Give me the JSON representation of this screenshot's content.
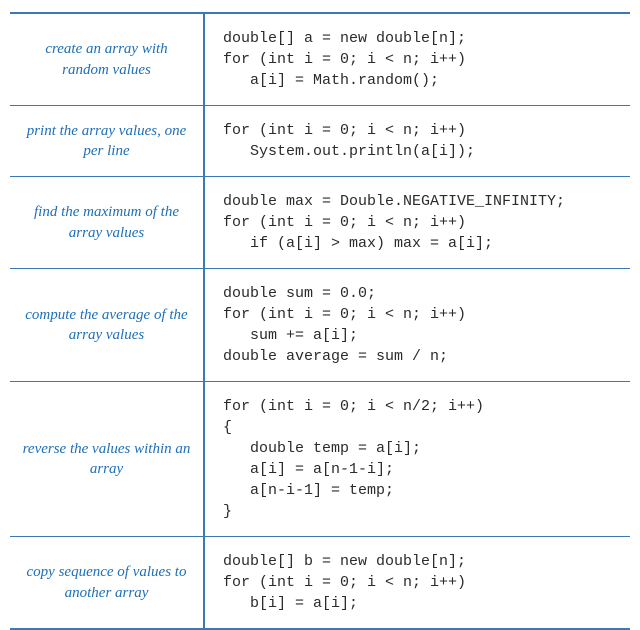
{
  "rows": [
    {
      "label": "create an array\nwith random values",
      "code": "double[] a = new double[n];\nfor (int i = 0; i < n; i++)\n   a[i] = Math.random();"
    },
    {
      "label": "print the array values,\none per line",
      "code": "for (int i = 0; i < n; i++)\n   System.out.println(a[i]);"
    },
    {
      "label": "find the maximum of\nthe array values",
      "code": "double max = Double.NEGATIVE_INFINITY;\nfor (int i = 0; i < n; i++)\n   if (a[i] > max) max = a[i];"
    },
    {
      "label": "compute the average of\nthe array values",
      "code": "double sum = 0.0;\nfor (int i = 0; i < n; i++)\n   sum += a[i];\ndouble average = sum / n;"
    },
    {
      "label": "reverse the values\nwithin an array",
      "code": "for (int i = 0; i < n/2; i++)\n{\n   double temp = a[i];\n   a[i] = a[n-1-i];\n   a[n-i-1] = temp;\n}"
    },
    {
      "label": "copy sequence of values\nto another array",
      "code": "double[] b = new double[n];\nfor (int i = 0; i < n; i++)\n   b[i] = a[i];"
    }
  ]
}
